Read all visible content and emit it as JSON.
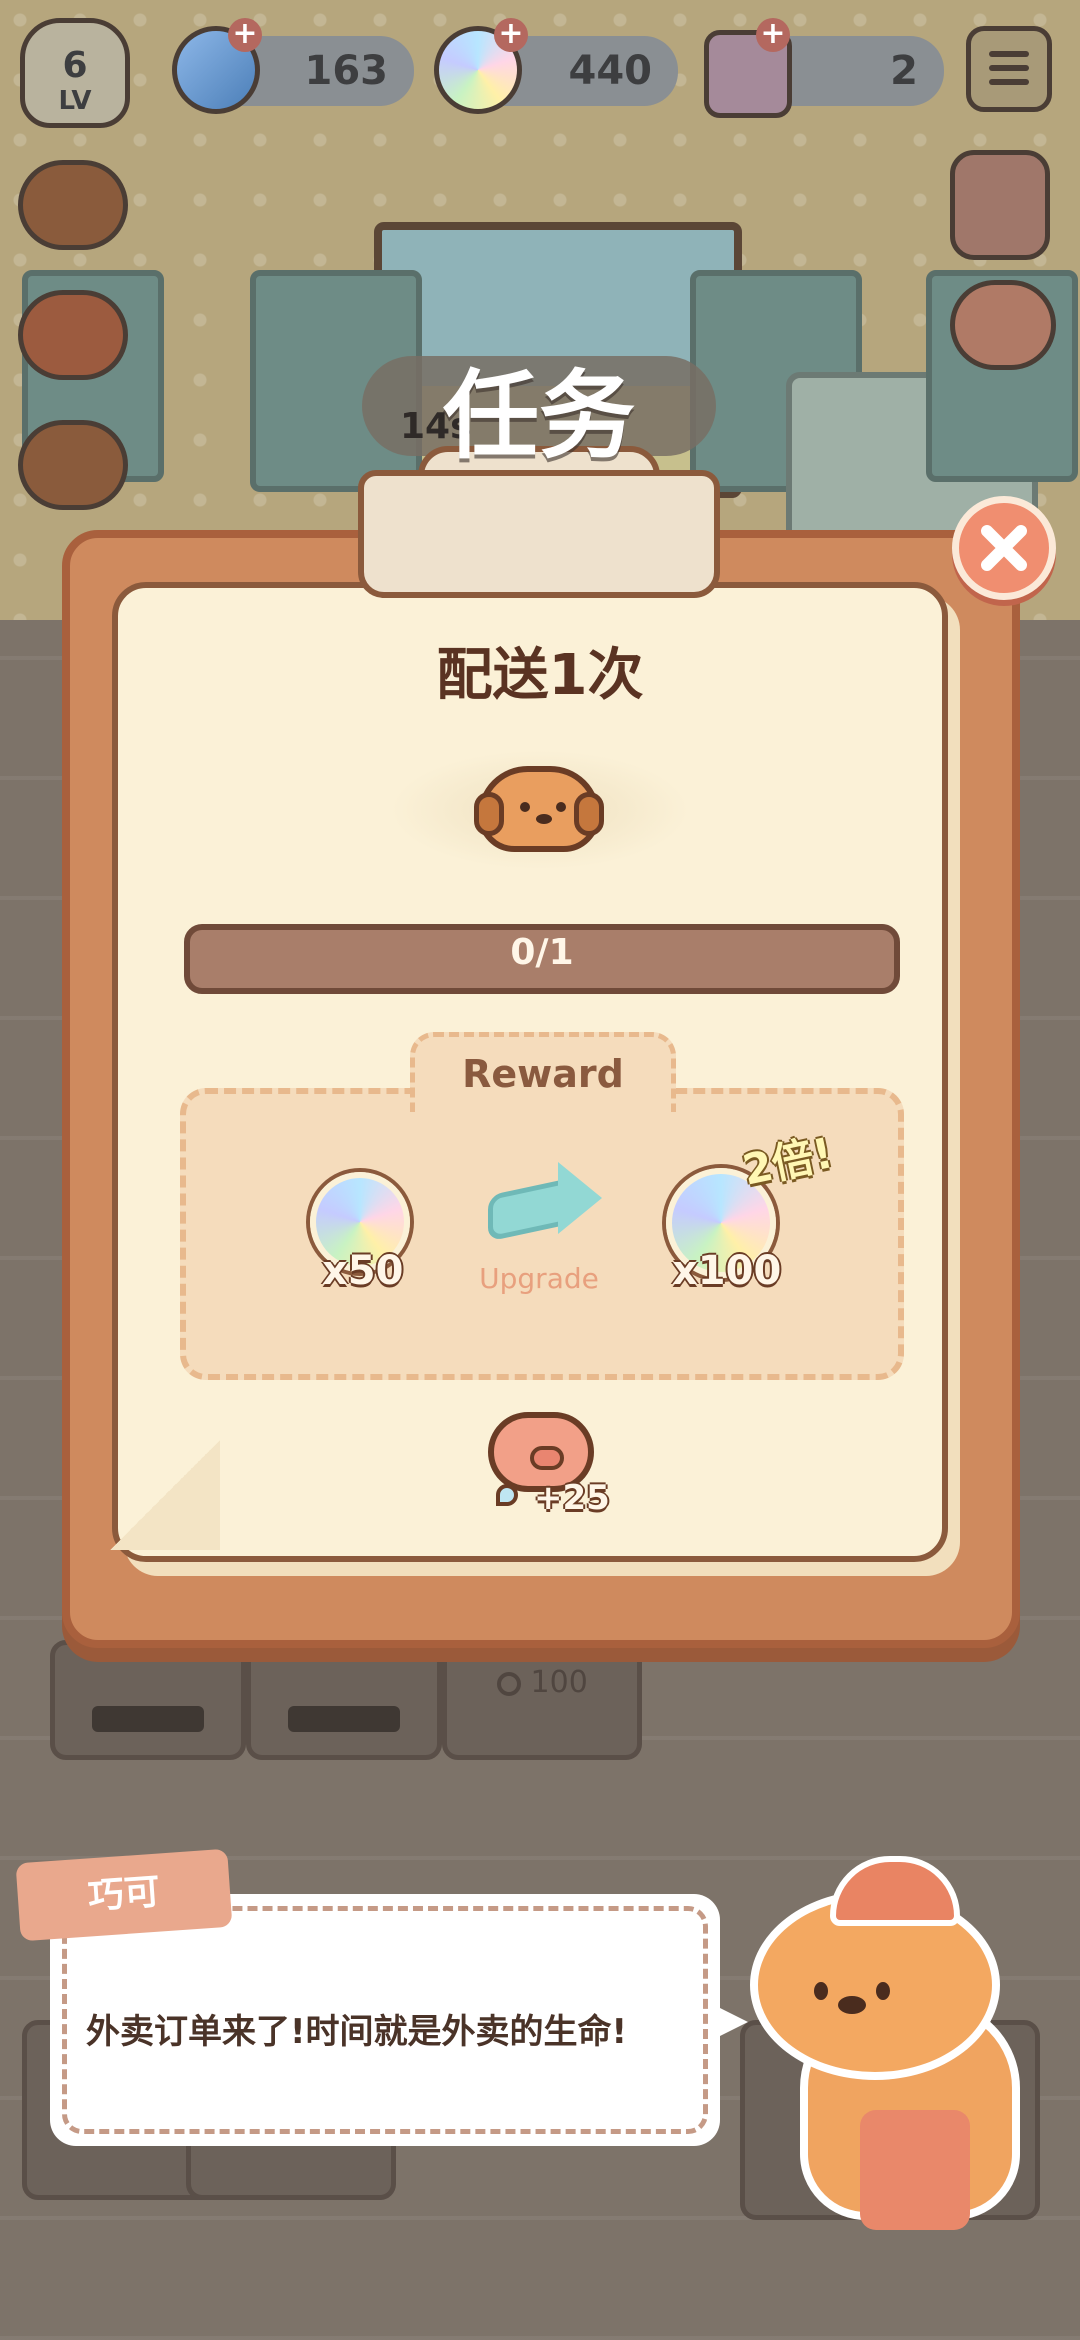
{
  "hud": {
    "level_number": "6",
    "level_suffix": "LV",
    "currency_blue": "163",
    "currency_gem": "440",
    "currency_ticket": "2",
    "plus_symbol": "+"
  },
  "scene": {
    "timer_text": "14s",
    "kitchen_price": "100"
  },
  "task": {
    "header": "任务",
    "title": "配送1次",
    "progress_text": "0/1",
    "progress_value": 0,
    "progress_max": 1,
    "reward_label": "Reward",
    "reward_base_count": "x50",
    "upgrade_label": "Upgrade",
    "reward_upgraded_count": "x100",
    "double_tag": "2倍!",
    "bonus_text": "+25"
  },
  "dialog": {
    "speaker": "巧可",
    "message": "外卖订单来了!时间就是外卖的生命!"
  },
  "colors": {
    "board": "#cf8a5e",
    "paper": "#fbf1d7",
    "progress_track": "#a97e6a",
    "reward_bg": "#f5dcbc",
    "close_button": "#f08e70"
  }
}
